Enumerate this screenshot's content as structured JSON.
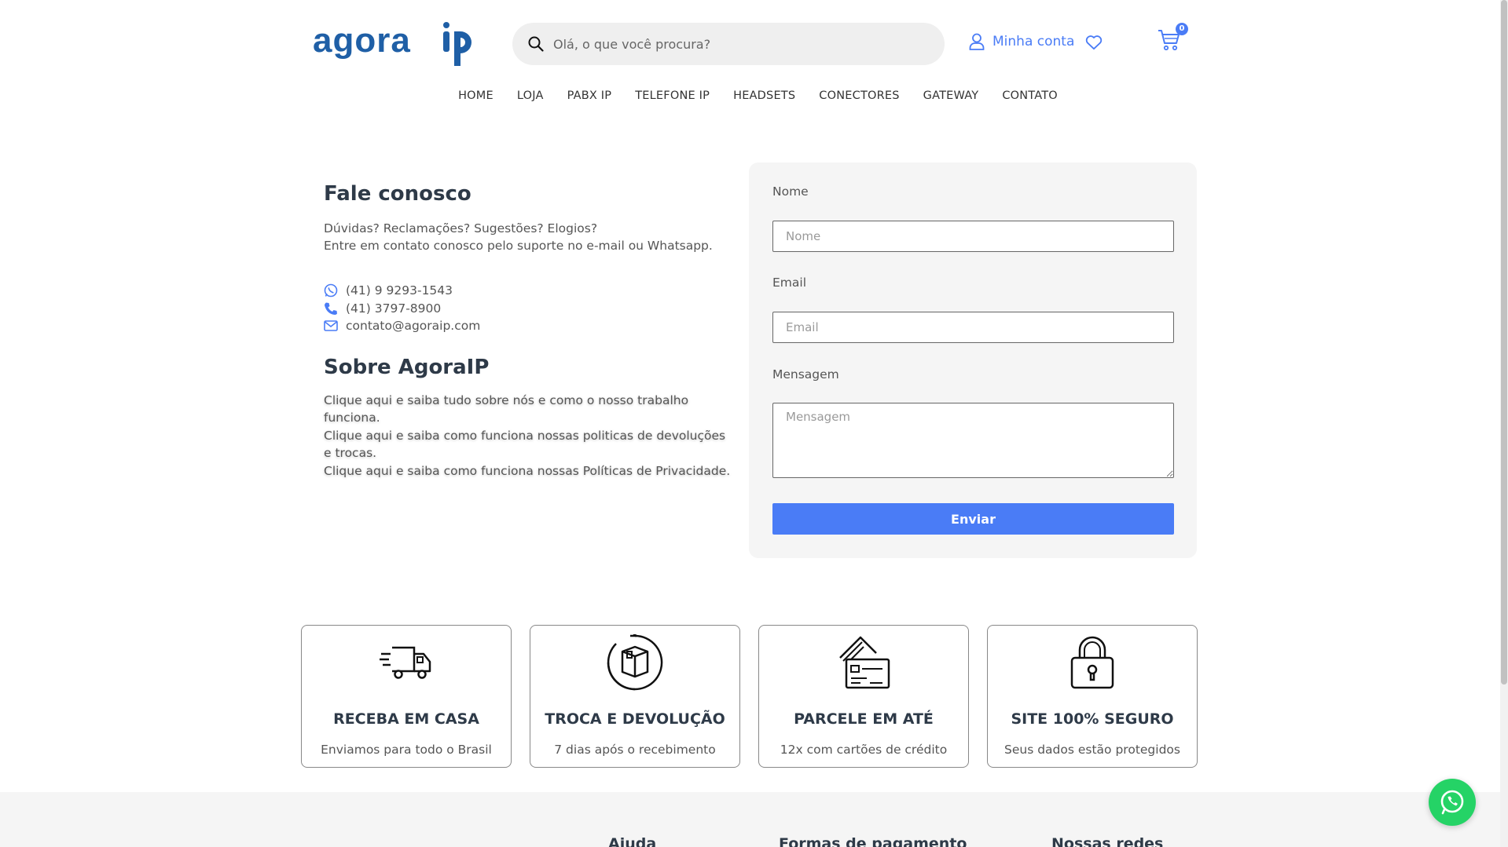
{
  "header": {
    "logo_text": "agora ip",
    "search_placeholder": "Olá, o que você procura?",
    "account_label": "Minha conta",
    "cart_count": "0"
  },
  "nav": {
    "items": [
      "HOME",
      "LOJA",
      "PABX IP",
      "TELEFONE IP",
      "HEADSETS",
      "CONECTORES",
      "GATEWAY",
      "CONTATO"
    ]
  },
  "contact": {
    "title": "Fale conosco",
    "intro_line1": "Dúvidas? Reclamações? Sugestões? Elogios?",
    "intro_line2": "Entre em contato conosco pelo suporte no e-mail ou Whatsapp.",
    "whatsapp": "(41) 9 9293-1543",
    "phone": "(41) 3797-8900",
    "email": "contato@agoraip.com"
  },
  "about": {
    "title": "Sobre AgoraIP",
    "line1": "Clique aqui e saiba tudo sobre nós e como o nosso trabalho funciona.",
    "line2": "Clique aqui e saiba como funciona nossas politicas de devoluções e trocas.",
    "line3": "Clique aqui e saiba como funciona nossas Políticas de Privacidade."
  },
  "form": {
    "name_label": "Nome",
    "name_placeholder": "Nome",
    "email_label": "Email",
    "email_placeholder": "Email",
    "message_label": "Mensagem",
    "message_placeholder": "Mensagem",
    "submit_label": "Enviar"
  },
  "features": [
    {
      "title": "RECEBA EM CASA",
      "sub": "Enviamos para todo o Brasil",
      "icon": "delivery-truck-icon"
    },
    {
      "title": "TROCA E DEVOLUÇÃO",
      "sub": "7 dias após o recebimento",
      "icon": "return-box-icon"
    },
    {
      "title": "PARCELE EM ATÉ",
      "sub": "12x com cartões de crédito",
      "icon": "credit-card-icon"
    },
    {
      "title": "SITE 100% SEGURO",
      "sub": "Seus dados estão protegidos",
      "icon": "padlock-icon"
    }
  ],
  "footer": {
    "col1": "Ajuda",
    "col2": "Formas de pagamento",
    "col3": "Nossas redes"
  },
  "colors": {
    "accent": "#4a7cf6",
    "logo_blue": "#1f5fa6",
    "whatsapp": "#25d366"
  }
}
